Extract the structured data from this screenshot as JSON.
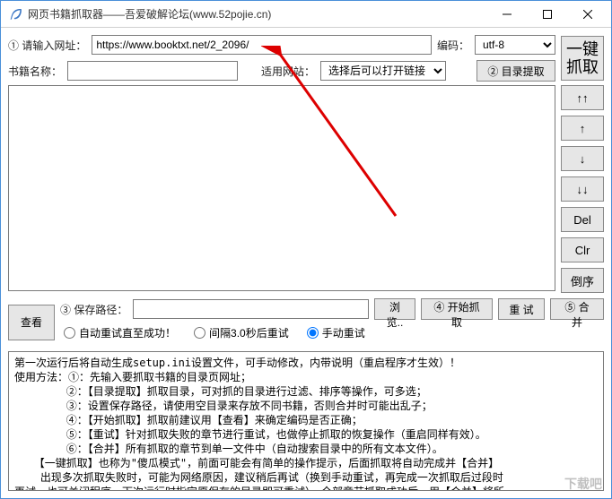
{
  "window": {
    "title": "网页书籍抓取器——吾爱破解论坛(www.52pojie.cn)"
  },
  "form": {
    "url_label": "① 请输入网址：",
    "url_value": "https://www.booktxt.net/2_2096/",
    "encoding_label": "编码：",
    "encoding_value": "utf-8",
    "bookname_label": "书籍名称：",
    "bookname_value": "",
    "site_label": "适用网站：",
    "site_value": "选择后可以打开链接",
    "dir_extract_btn": "② 目录提取",
    "onekey_btn": "一键\n抓取"
  },
  "side": {
    "up2": "↑↑",
    "up1": "↑",
    "dn1": "↓",
    "dn2": "↓↓",
    "del": "Del",
    "clr": "Clr",
    "rev": "倒序"
  },
  "path": {
    "view_btn": "查看",
    "label": "③ 保存路径：",
    "value": "",
    "browse_btn": "浏览..",
    "start_btn": "④ 开始抓取",
    "retry_btn": "重 试",
    "merge_btn": "⑤ 合并"
  },
  "radio": {
    "r1": "自动重试直至成功！",
    "r2": "间隔3.0秒后重试",
    "r3": "手动重试"
  },
  "log": "第一次运行后将自动生成setup.ini设置文件，可手动修改，内带说明（重启程序才生效）！\n使用方法：①：先输入要抓取书籍的目录页网址；\n        ②：【目录提取】抓取目录，可对抓的目录进行过滤、排序等操作，可多选；\n        ③：设置保存路径，请使用空目录来存放不同书籍，否则合并时可能出乱子；\n        ④：【开始抓取】抓取前建议用【查看】来确定编码是否正确；\n        ⑤：【重试】针对抓取失败的章节进行重试，也做停止抓取的恢复操作（重启同样有效）。\n        ⑥：【合并】所有抓取的章节到单一文件中（自动搜索目录中的所有文本文件）。\n   【一键抓取】也称为\"傻瓜模式\"，前面可能会有简单的操作提示，后面抓取将自动完成并【合并】\n    出现多次抓取失败时，可能为网络原因，建议稍后再试（换到手动重试，再完成一次抓取后过段时\n再试。也可关闭程序，下次运行时指定原保存的目录即可重试）。全部章节抓取成功后，用【合并】将所",
  "watermark": "下载吧"
}
